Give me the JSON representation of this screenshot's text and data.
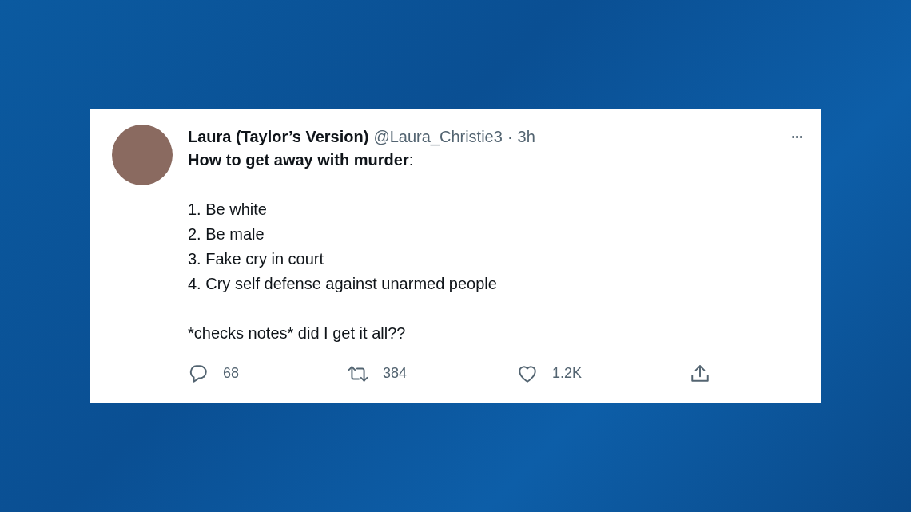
{
  "tweet": {
    "name": "Laura (Taylor’s Version)",
    "handle": "@Laura_Christie3",
    "separator": "·",
    "time": "3h",
    "more": "•••",
    "heading": "**How to get away with murder**:",
    "list": [
      "1. Be white",
      "2. Be male",
      "3. Fake cry in court",
      "4. Cry self defense against unarmed people"
    ],
    "closing": "*checks notes* did I get it all??",
    "actions": [
      {
        "kind": "reply",
        "count": "68"
      },
      {
        "kind": "retweet",
        "count": "384"
      },
      {
        "kind": "like",
        "count": "1.2K"
      },
      {
        "kind": "share"
      }
    ]
  }
}
